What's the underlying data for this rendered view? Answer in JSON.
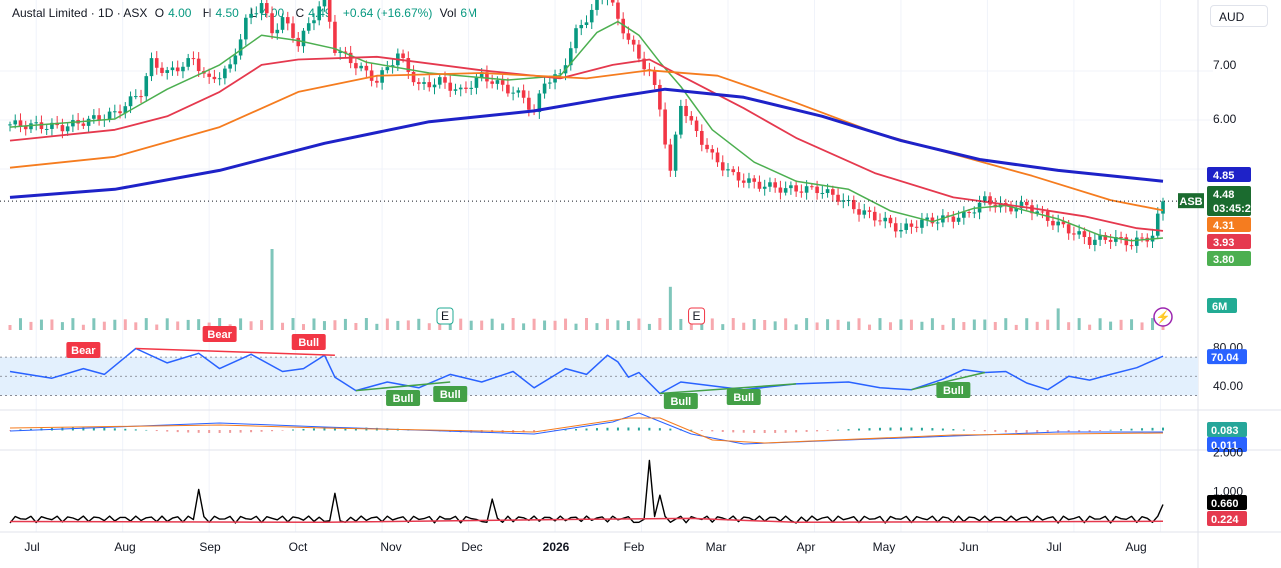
{
  "header": {
    "title": "Austal Limited · 1D · ASX",
    "open_label": "O",
    "open": "4.00",
    "high_label": "H",
    "high": "4.50",
    "low_label": "L",
    "low": "4.00",
    "close_label": "C",
    "close": "4.49",
    "change": "+0.64 (+16.67%)",
    "vol_label": "Vol",
    "vol": "6M"
  },
  "currency": "AUD",
  "colors": {
    "up": "#089981",
    "down": "#f23645",
    "ma200": "#1e22c8",
    "ma100": "#f57c1f",
    "ma50": "#e5394e",
    "ma20": "#4caf50",
    "rsi": "#2962ff",
    "rsi_band": "#e3f0fd",
    "bull": "#43a047",
    "bear": "#f23645",
    "macd": "#2962ff",
    "signal": "#f57c1f",
    "atr": "#000000",
    "atr_ma": "#e5394e"
  },
  "chart_data": {
    "type": "line",
    "symbol": "ASB",
    "x_ticks": [
      "Jul",
      "Aug",
      "Sep",
      "Oct",
      "Nov",
      "Dec",
      "2026",
      "Feb",
      "Mar",
      "Apr",
      "May",
      "Jun",
      "Jul",
      "Aug"
    ],
    "price_axis": {
      "ticks": [
        "7.00",
        "6.00",
        "5.00"
      ],
      "ylim": [
        3.3,
        8.2
      ]
    },
    "price_series": [
      {
        "name": "close",
        "points": [
          [
            0,
            5.9
          ],
          [
            10,
            5.85
          ],
          [
            20,
            6.1
          ],
          [
            25,
            6.5
          ],
          [
            27,
            7.05
          ],
          [
            30,
            6.85
          ],
          [
            35,
            7.1
          ],
          [
            38,
            6.7
          ],
          [
            42,
            6.95
          ],
          [
            45,
            7.8
          ],
          [
            48,
            8.15
          ],
          [
            50,
            7.6
          ],
          [
            52,
            7.85
          ],
          [
            55,
            7.4
          ],
          [
            58,
            7.9
          ],
          [
            60,
            8.3
          ],
          [
            62,
            7.3
          ],
          [
            66,
            7.0
          ],
          [
            70,
            6.7
          ],
          [
            74,
            7.2
          ],
          [
            78,
            6.6
          ],
          [
            82,
            6.7
          ],
          [
            86,
            6.5
          ],
          [
            90,
            6.8
          ],
          [
            94,
            6.6
          ],
          [
            98,
            6.4
          ],
          [
            100,
            6.1
          ],
          [
            102,
            6.7
          ],
          [
            105,
            6.8
          ],
          [
            108,
            7.6
          ],
          [
            111,
            8.0
          ],
          [
            114,
            8.4
          ],
          [
            116,
            7.8
          ],
          [
            118,
            7.5
          ],
          [
            120,
            7.1
          ],
          [
            122,
            6.9
          ],
          [
            124,
            6.2
          ],
          [
            126,
            5.0
          ],
          [
            128,
            6.3
          ],
          [
            130,
            5.9
          ],
          [
            134,
            5.3
          ],
          [
            138,
            4.95
          ],
          [
            142,
            4.8
          ],
          [
            148,
            4.7
          ],
          [
            154,
            4.7
          ],
          [
            158,
            4.55
          ],
          [
            162,
            4.3
          ],
          [
            166,
            4.15
          ],
          [
            170,
            3.95
          ],
          [
            174,
            4.1
          ],
          [
            178,
            4.15
          ],
          [
            182,
            4.2
          ],
          [
            186,
            4.5
          ],
          [
            190,
            4.35
          ],
          [
            194,
            4.4
          ],
          [
            198,
            4.15
          ],
          [
            202,
            3.95
          ],
          [
            206,
            3.75
          ],
          [
            210,
            3.8
          ],
          [
            214,
            3.7
          ],
          [
            218,
            3.85
          ],
          [
            220,
            4.49
          ]
        ]
      },
      {
        "name": "MA20",
        "points": [
          [
            0,
            5.85
          ],
          [
            20,
            6.0
          ],
          [
            30,
            6.55
          ],
          [
            40,
            7.0
          ],
          [
            48,
            7.55
          ],
          [
            55,
            7.45
          ],
          [
            62,
            7.3
          ],
          [
            68,
            7.05
          ],
          [
            80,
            6.85
          ],
          [
            95,
            6.72
          ],
          [
            105,
            6.8
          ],
          [
            112,
            7.6
          ],
          [
            116,
            7.8
          ],
          [
            120,
            7.55
          ],
          [
            124,
            7.05
          ],
          [
            128,
            6.6
          ],
          [
            134,
            5.8
          ],
          [
            142,
            5.2
          ],
          [
            150,
            4.85
          ],
          [
            160,
            4.7
          ],
          [
            168,
            4.3
          ],
          [
            176,
            4.1
          ],
          [
            184,
            4.35
          ],
          [
            190,
            4.4
          ],
          [
            200,
            4.15
          ],
          [
            208,
            3.85
          ],
          [
            214,
            3.75
          ],
          [
            220,
            3.8
          ]
        ]
      },
      {
        "name": "MA50",
        "points": [
          [
            0,
            5.6
          ],
          [
            20,
            5.8
          ],
          [
            30,
            6.05
          ],
          [
            40,
            6.5
          ],
          [
            48,
            7.0
          ],
          [
            55,
            7.1
          ],
          [
            70,
            7.15
          ],
          [
            90,
            6.9
          ],
          [
            105,
            6.75
          ],
          [
            115,
            7.0
          ],
          [
            122,
            7.1
          ],
          [
            130,
            6.7
          ],
          [
            140,
            6.2
          ],
          [
            150,
            5.65
          ],
          [
            165,
            5.0
          ],
          [
            180,
            4.55
          ],
          [
            195,
            4.35
          ],
          [
            205,
            4.2
          ],
          [
            215,
            3.98
          ],
          [
            220,
            3.93
          ]
        ]
      },
      {
        "name": "MA100",
        "points": [
          [
            0,
            5.1
          ],
          [
            20,
            5.3
          ],
          [
            40,
            5.85
          ],
          [
            55,
            6.5
          ],
          [
            70,
            6.8
          ],
          [
            90,
            6.85
          ],
          [
            110,
            6.75
          ],
          [
            122,
            6.9
          ],
          [
            135,
            6.8
          ],
          [
            150,
            6.3
          ],
          [
            165,
            5.75
          ],
          [
            180,
            5.35
          ],
          [
            195,
            4.95
          ],
          [
            210,
            4.5
          ],
          [
            220,
            4.31
          ]
        ]
      },
      {
        "name": "MA200",
        "points": [
          [
            0,
            4.55
          ],
          [
            20,
            4.7
          ],
          [
            40,
            5.05
          ],
          [
            60,
            5.55
          ],
          [
            80,
            5.95
          ],
          [
            100,
            6.15
          ],
          [
            115,
            6.4
          ],
          [
            125,
            6.55
          ],
          [
            140,
            6.4
          ],
          [
            155,
            6.05
          ],
          [
            170,
            5.6
          ],
          [
            185,
            5.25
          ],
          [
            200,
            5.05
          ],
          [
            215,
            4.9
          ],
          [
            220,
            4.85
          ]
        ]
      }
    ],
    "price_badges": [
      {
        "label": "4.85",
        "value": 4.85,
        "color": "#1e22c8"
      },
      {
        "label": "4.48",
        "sub": "03:45:25",
        "value": 4.48,
        "color": "#1b6b2f"
      },
      {
        "label": "4.31",
        "value": 4.31,
        "color": "#f57c1f"
      },
      {
        "label": "3.93",
        "value": 3.93,
        "color": "#e5394e"
      },
      {
        "label": "3.80",
        "value": 3.8,
        "color": "#4caf50"
      }
    ],
    "volume": {
      "label": "6M",
      "spikes": [
        [
          50,
          4.5
        ],
        [
          126,
          2.4
        ],
        [
          127,
          1.7
        ],
        [
          200,
          1.2
        ],
        [
          220,
          0.8
        ]
      ]
    },
    "rsi": {
      "ticks": [
        "80.00",
        "40.00"
      ],
      "ylim": [
        20,
        90
      ],
      "current": "70.04",
      "points": [
        [
          0,
          55
        ],
        [
          8,
          48
        ],
        [
          14,
          58
        ],
        [
          18,
          52
        ],
        [
          24,
          79
        ],
        [
          30,
          64
        ],
        [
          36,
          74
        ],
        [
          40,
          58
        ],
        [
          46,
          73
        ],
        [
          52,
          55
        ],
        [
          56,
          58
        ],
        [
          60,
          72
        ],
        [
          62,
          49
        ],
        [
          66,
          35
        ],
        [
          72,
          44
        ],
        [
          78,
          38
        ],
        [
          84,
          52
        ],
        [
          90,
          44
        ],
        [
          96,
          55
        ],
        [
          100,
          38
        ],
        [
          106,
          58
        ],
        [
          110,
          52
        ],
        [
          114,
          72
        ],
        [
          116,
          65
        ],
        [
          118,
          49
        ],
        [
          120,
          54
        ],
        [
          124,
          32
        ],
        [
          128,
          44
        ],
        [
          134,
          40
        ],
        [
          140,
          36
        ],
        [
          150,
          42
        ],
        [
          160,
          44
        ],
        [
          166,
          38
        ],
        [
          172,
          36
        ],
        [
          178,
          47
        ],
        [
          182,
          57
        ],
        [
          186,
          54
        ],
        [
          190,
          55
        ],
        [
          194,
          43
        ],
        [
          198,
          36
        ],
        [
          202,
          50
        ],
        [
          206,
          46
        ],
        [
          210,
          52
        ],
        [
          215,
          59
        ],
        [
          220,
          71
        ]
      ],
      "divergences": [
        {
          "type": "Bear"
        },
        {
          "type": "Bear"
        },
        {
          "type": "Bull"
        },
        {
          "type": "Bull"
        },
        {
          "type": "Bull"
        },
        {
          "type": "Bull"
        },
        {
          "type": "Bull"
        },
        {
          "type": "Bull"
        }
      ],
      "event_marks": [
        "E",
        "E"
      ]
    },
    "macd": {
      "macd_label": "0.083",
      "signal_label": "0.011"
    },
    "atr": {
      "ticks": [
        "2.000",
        "1.000"
      ],
      "ylim": [
        0,
        2.2
      ],
      "current": "0.660",
      "ma_current": "0.224",
      "points": [
        [
          0,
          0.18
        ],
        [
          30,
          0.22
        ],
        [
          36,
          1.05
        ],
        [
          38,
          0.2
        ],
        [
          60,
          0.22
        ],
        [
          62,
          0.95
        ],
        [
          64,
          0.2
        ],
        [
          90,
          0.22
        ],
        [
          92,
          0.8
        ],
        [
          94,
          0.2
        ],
        [
          120,
          0.2
        ],
        [
          122,
          1.8
        ],
        [
          124,
          0.9
        ],
        [
          126,
          0.2
        ],
        [
          150,
          0.18
        ],
        [
          180,
          0.2
        ],
        [
          200,
          0.18
        ],
        [
          218,
          0.2
        ],
        [
          220,
          0.66
        ]
      ]
    }
  }
}
